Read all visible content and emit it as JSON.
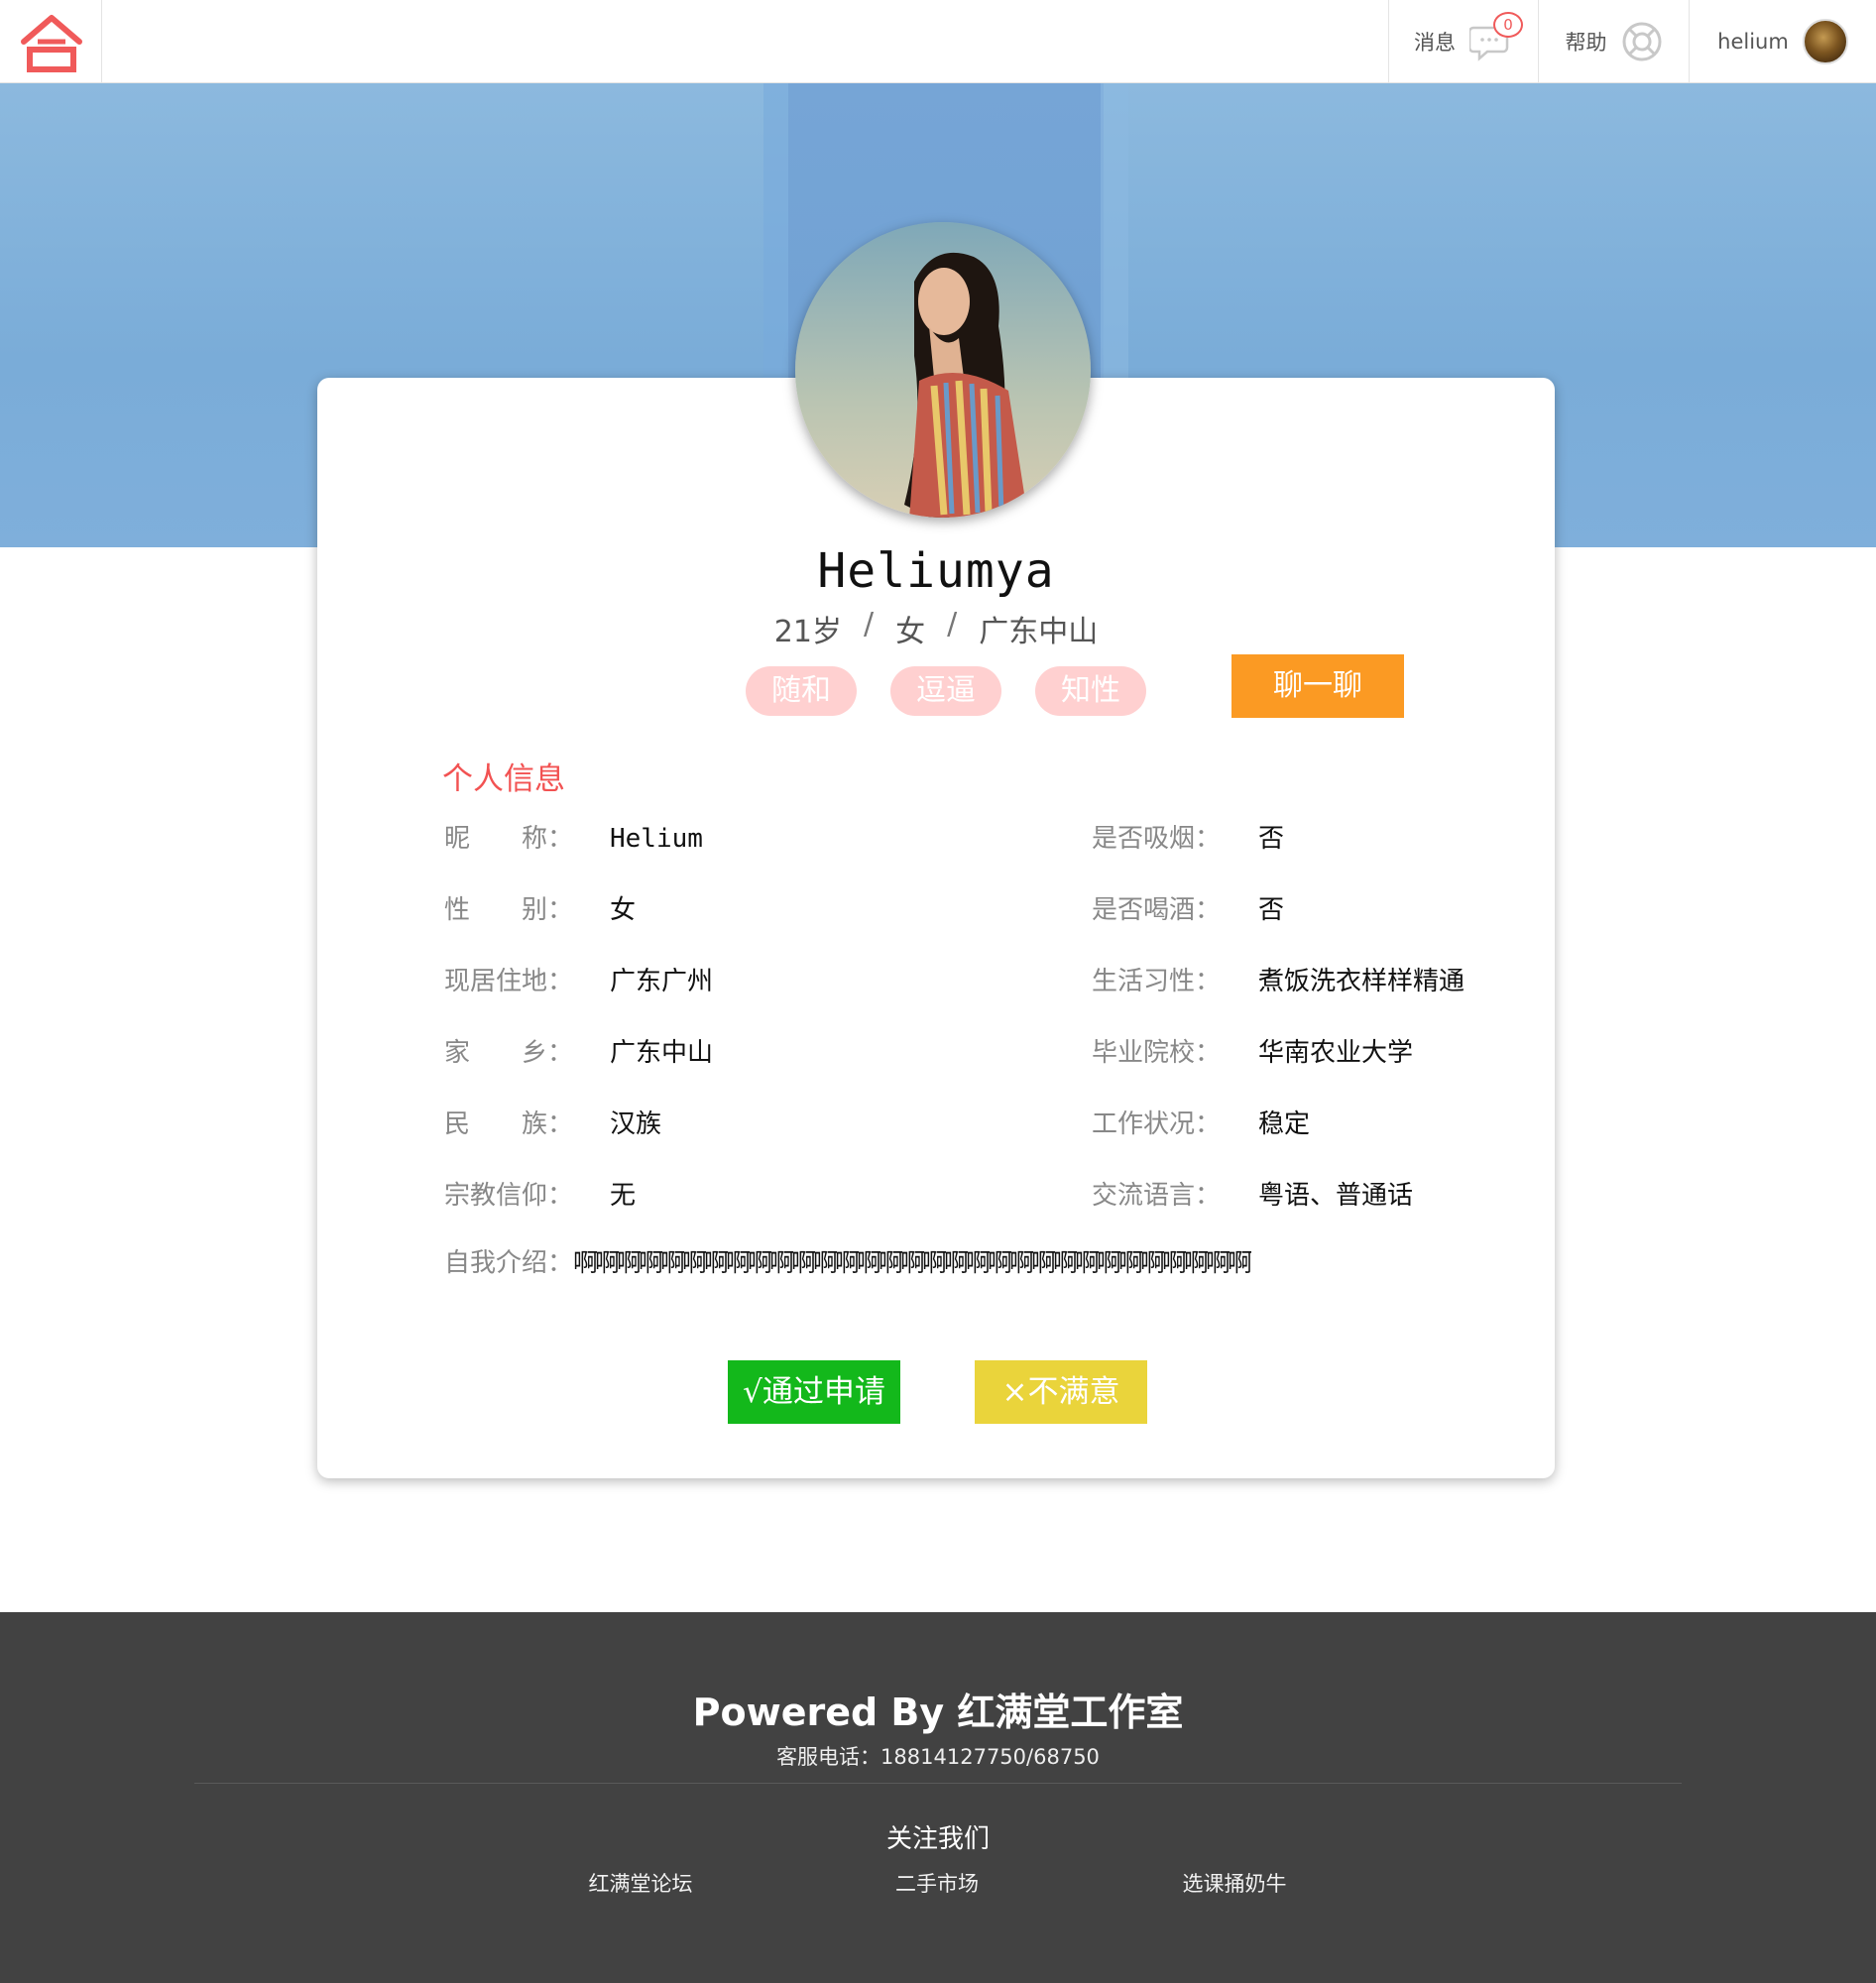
{
  "nav": {
    "logo_icon": "house-logo-icon",
    "messages_label": "消息",
    "messages_count": "0",
    "help_label": "帮助",
    "username": "helium"
  },
  "profile": {
    "name": "Heliumya",
    "age": "21岁",
    "sep": "/",
    "gender": "女",
    "location": "广东中山",
    "tags": [
      "随和",
      "逗逼",
      "知性"
    ],
    "chat_button": "聊一聊"
  },
  "info": {
    "section_title": "个人信息",
    "left": [
      {
        "label": "昵　　称：",
        "value": "Helium"
      },
      {
        "label": "性　　别：",
        "value": "女"
      },
      {
        "label": "现居住地：",
        "value": "广东广州"
      },
      {
        "label": "家　　乡：",
        "value": "广东中山"
      },
      {
        "label": "民　　族：",
        "value": "汉族"
      },
      {
        "label": "宗教信仰：",
        "value": "无"
      }
    ],
    "right": [
      {
        "label": "是否吸烟：",
        "value": "否"
      },
      {
        "label": "是否喝酒：",
        "value": "否"
      },
      {
        "label": "生活习性：",
        "value": "煮饭洗衣样样精通"
      },
      {
        "label": "毕业院校：",
        "value": "华南农业大学"
      },
      {
        "label": "工作状况：",
        "value": "稳定"
      },
      {
        "label": "交流语言：",
        "value": "粤语、普通话"
      }
    ],
    "intro_label": "自我介绍：",
    "intro_value": "啊啊啊啊啊啊啊啊啊啊啊啊啊啊啊啊啊啊啊啊啊啊啊啊啊啊啊啊啊啊啊"
  },
  "actions": {
    "approve": "√通过申请",
    "reject": "×不满意"
  },
  "footer": {
    "powered": "Powered By 红满堂工作室",
    "hotline": "客服电话：18814127750/68750",
    "follow": "关注我们",
    "links": [
      "红满堂论坛",
      "二手市场",
      "选课捅奶牛"
    ]
  },
  "colors": {
    "brand_red": "#f25252",
    "chat_orange": "#fb9a23",
    "approve_green": "#13b81b",
    "reject_yellow": "#ead43b",
    "tag_pink": "#ffd0d0",
    "footer_bg": "#424242"
  }
}
